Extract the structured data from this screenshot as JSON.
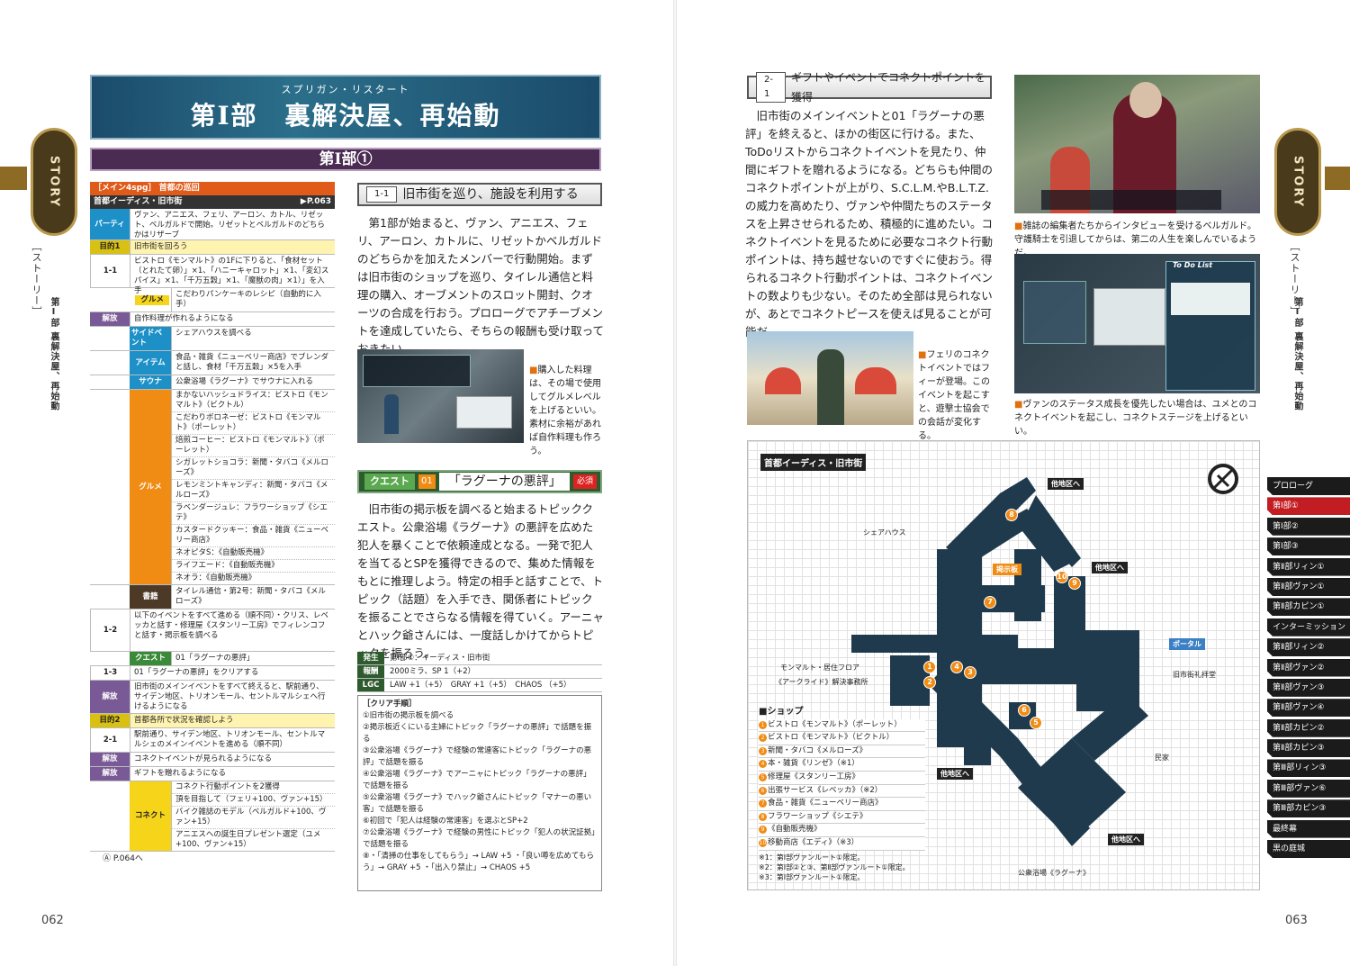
{
  "sidebar_left": {
    "tab": "STORY",
    "subtitle": "［ストーリー］",
    "vertical": "第Ⅰ部 裏解決屋、再始動"
  },
  "sidebar_right": {
    "tab": "STORY",
    "subtitle": "［ストーリー］",
    "vertical": "第Ⅰ部 裏解決屋、再始動"
  },
  "title": {
    "ruby": "スプリガン・リスタート",
    "main": "第Ⅰ部　裏解決屋、再始動",
    "sub": "第Ⅰ部①"
  },
  "table": {
    "header": "［メイン4spg］ 首都の巡回",
    "location": "首都イーディス・旧市街",
    "location_ref": "▶P.063",
    "party_label": "パーティ",
    "party_text": "ヴァン、アニエス、フェリ、アーロン、カトル、リゼット、ベルガルドで開始。リゼットとベルガルドのどちらかはリザーブ",
    "goal1_label": "目的1",
    "goal1": "旧市街を回ろう",
    "r11_label": "1-1",
    "r11": "ビストロ《モンマルト》の1Fに下りると、「食材セット（とれたて卵）」×1、「ハニーキャロット」×1、「変幻スパイス」×1、「千万五穀」×1、「魔獣の肉」×1）」を入手",
    "gurume_label": "グルメ",
    "gurume1": "こだわりパンケーキのレシピ（自動的に入手）",
    "unlock_label": "解放",
    "unlock1": "自作料理が作れるようになる",
    "subev_label": "サイドベント",
    "subev": "シェアハウスを調べる",
    "item_label": "アイテム",
    "item": "食品・雑貨《ニューベリー商店》でブレンダと話し、食材「千万五穀」×5を入手",
    "sauna_label": "サウナ",
    "sauna": "公衆浴場《ラグーナ》でサウナに入れる",
    "gurume2_label": "グルメ",
    "gurume_list": [
      "まかないハッシュドライス：ビストロ《モンマルト》（ビクトル）",
      "こだわりボロネーゼ：ビストロ《モンマルト》（ポーレット）",
      "焙煎コーヒー：ビストロ《モンマルト》（ポーレット）",
      "シガレットショコラ：新聞・タバコ《メルローズ》",
      "レモンミントキャンディ：新聞・タバコ《メルローズ》",
      "ラベンダージュレ：フラワーショップ《シエテ》",
      "カスタードクッキー：食品・雑貨《ニューベリー商店》",
      "ネオピタS：《自動販売機》",
      "ライフエード：《自動販売機》",
      "ネオラ：《自動販売機》"
    ],
    "book_label": "書籍",
    "book": "タイレル通信・第2号：新聞・タバコ《メルローズ》",
    "r12_label": "1-2",
    "r12": "以下のイベントをすべて進める（順不同）・クリス、レベッカと話す・修理屋《スタンリー工房》でフィレンコフと話す・掲示板を調べる",
    "quest_label": "クエスト",
    "quest": "01「ラグーナの悪評」",
    "r13_label": "1-3",
    "r13": "01「ラグーナの悪評」をクリアする",
    "unlock2_label": "解放",
    "unlock2": "旧市街のメインイベントをすべて終えると、駅前通り、サイデン地区、トリオンモール、セントルマルシェへ行けるようになる",
    "goal2_label": "目的2",
    "goal2": "首都各所で状況を確認しよう",
    "r21_label": "2-1",
    "r21": "駅前通り、サイデン地区、トリオンモール、セントルマルシェのメインイベントを進める（順不同）",
    "unlock3_label": "解放",
    "unlock3": "コネクトイベントが見られるようになる",
    "unlock4_label": "解放",
    "unlock4": "ギフトを贈れるようになる",
    "connect_label": "コネクト",
    "connect_list": [
      "コネクト行動ポイントを2獲得",
      "頂を目指して（フェリ+100、ヴァン+15）",
      "バイク雑誌のモデル（ベルガルド+100、ヴァン+15）",
      "アニエスへの誕生日プレゼント選定（ユメ+100、ヴァン+15）"
    ],
    "footer": "Ⓐ P.064へ"
  },
  "mid": {
    "h1_num": "1-1",
    "h1": "旧市街を巡り、施設を利用する",
    "p1": "第1部が始まると、ヴァン、アニエス、フェリ、アーロン、カトルに、リゼットかベルガルドのどちらかを加えたメンバーで行動開始。まずは旧市街のショップを巡り、タイレル通信と料理の購入、オーブメントのスロット開封、クオーツの合成を行おう。プロローグでアチーブメントを達成していたら、そちらの報酬も受け取っておきたい。",
    "cap1": "購入した料理は、その場で使用してグルメレベルを上げるといい。素材に余裕があれば自作料理も作ろう。",
    "quest_tag": "クエスト",
    "quest_no": "01",
    "quest_title": "「ラグーナの悪評」",
    "quest_must": "必須",
    "p2": "旧市街の掲示板を調べると始まるトピッククエスト。公衆浴場《ラグーナ》の悪評を広めた犯人を暴くことで依頼達成となる。一発で犯人を当てるとSPを獲得できるので、集めた情報をもとに推理しよう。特定の相手と話すことで、トピック（話題）を入手でき、関係者にトピックを振ることでさらなる情報を得ていく。アーニャとハック爺さんには、一度話しかけてからトピックを振ろう。",
    "info": [
      {
        "k": "発生",
        "v": "第Ⅰ部①：イーディス・旧市街"
      },
      {
        "k": "報酬",
        "v": "2000ミラ、SP 1（+2）"
      },
      {
        "k": "LGC",
        "v": "LAW +1（+5）　GRAY +1（+5）　CHAOS （+5）"
      }
    ],
    "steps_title": "［クリア手順］",
    "steps": [
      "①旧市街の掲示板を調べる",
      "②掲示板近くにいる主婦にトピック「ラグーナの悪評」で話題を振る",
      "③公衆浴場《ラグーナ》で経験の常連客にトピック「ラグーナの悪評」で話題を振る",
      "④公衆浴場《ラグーナ》でアーニャにトピック「ラグーナの悪評」で話題を振る",
      "⑤公衆浴場《ラグーナ》でハック爺さんにトピック「マナーの悪い客」で話題を振る",
      "⑥初回で「犯人は経験の常連客」を選ぶとSP+2",
      "⑦公衆浴場《ラグーナ》で経験の男性にトピック「犯人の状況証拠」で話題を振る",
      "⑧・「清掃の仕事をしてもらう」→ LAW +5 ・「良い噂を広めてもらう」→ GRAY +5 ・「出入り禁止」→ CHAOS +5"
    ]
  },
  "right": {
    "h_num": "2-1",
    "h": "ギフトやイベントでコネクトポイントを獲得",
    "p": "旧市街のメインイベントと01「ラグーナの悪評」を終えると、ほかの街区に行ける。また、ToDoリストからコネクトイベントを見たり、仲間にギフトを贈れるようになる。どちらも仲間のコネクトポイントが上がり、S.C.L.M.やB.L.T.Z.の威力を高めたり、ヴァンや仲間たちのステータスを上昇させられるため、積極的に進めたい。コネクトイベントを見るために必要なコネクト行動ポイントは、持ち越せないのですぐに使おう。得られるコネクト行動ポイントは、コネクトイベントの数よりも少ない。そのため全部は見られないが、あとでコネクトピースを使えば見ることが可能だ。",
    "cap_top": "雑誌の編集者たちからインタビューを受けるベルガルド。守護騎士を引退してからは、第二の人生を楽しんでいるようだ。",
    "cap_feri": "フェリのコネクトイベントではフィーが登場。このイベントを起こすと、遊撃士協会での会話が変化する。",
    "cap_todo": "ヴァンのステータス成長を優先したい場合は、ユメとのコネクトイベントを起こし、コネクトステージを上げるといい。",
    "todo_title": "To Do List"
  },
  "map": {
    "title": "首都イーディス・旧市街",
    "labels": {
      "share": "シェアハウス",
      "other1": "他地区へ",
      "other2": "他地区へ",
      "other3": "他地区へ",
      "other4": "他地区へ",
      "board": "掲示板",
      "portal": "ポータル",
      "church": "旧市街礼拝堂",
      "mont": "モンマルト・居住フロア",
      "arc": "《アークライド》解決事務所",
      "house": "民家",
      "bath": "公衆浴場《ラグーナ》"
    },
    "shop_title": "■ショップ",
    "shops": [
      "ビストロ《モンマルト》（ポーレット）",
      "ビストロ《モンマルト》（ビクトル）",
      "新聞・タバコ《メルローズ》",
      "本・雑貨《リンゼ》（※1）",
      "修理屋《スタンリー工房》",
      "出張サービス《レベッカ》（※2）",
      "食品・雑貨《ニューベリー商店》",
      "フラワーショップ《シエテ》",
      "《自動販売機》",
      "移動商店《エディ》（※3）"
    ],
    "notes": [
      "※1：第Ⅰ部ヴァンルート①限定。",
      "※2：第Ⅰ部②と③、第Ⅱ部ヴァンルート①限定。",
      "※3：第Ⅰ部ヴァンルート①限定。"
    ]
  },
  "nav": [
    "プロローグ",
    "第Ⅰ部①",
    "第Ⅰ部②",
    "第Ⅰ部③",
    "第Ⅱ部リィン①",
    "第Ⅱ部ヴァン①",
    "第Ⅱ部カピン①",
    "インターミッション",
    "第Ⅱ部リィン②",
    "第Ⅱ部ヴァン②",
    "第Ⅱ部ヴァン③",
    "第Ⅱ部ヴァン④",
    "第Ⅱ部カピン②",
    "第Ⅱ部カピン③",
    "第Ⅲ部リィン③",
    "第Ⅲ部ヴァン⑥",
    "第Ⅲ部カピン③",
    "最終幕",
    "黒の庭城"
  ],
  "pages": {
    "left": "062",
    "right": "063"
  },
  "colors": {
    "title_blue": "#1b4b6b",
    "sub_purple": "#4a2b52",
    "accent_orange": "#f08c14",
    "nav_active": "#c21d23",
    "map_block": "#1f3a4d"
  }
}
